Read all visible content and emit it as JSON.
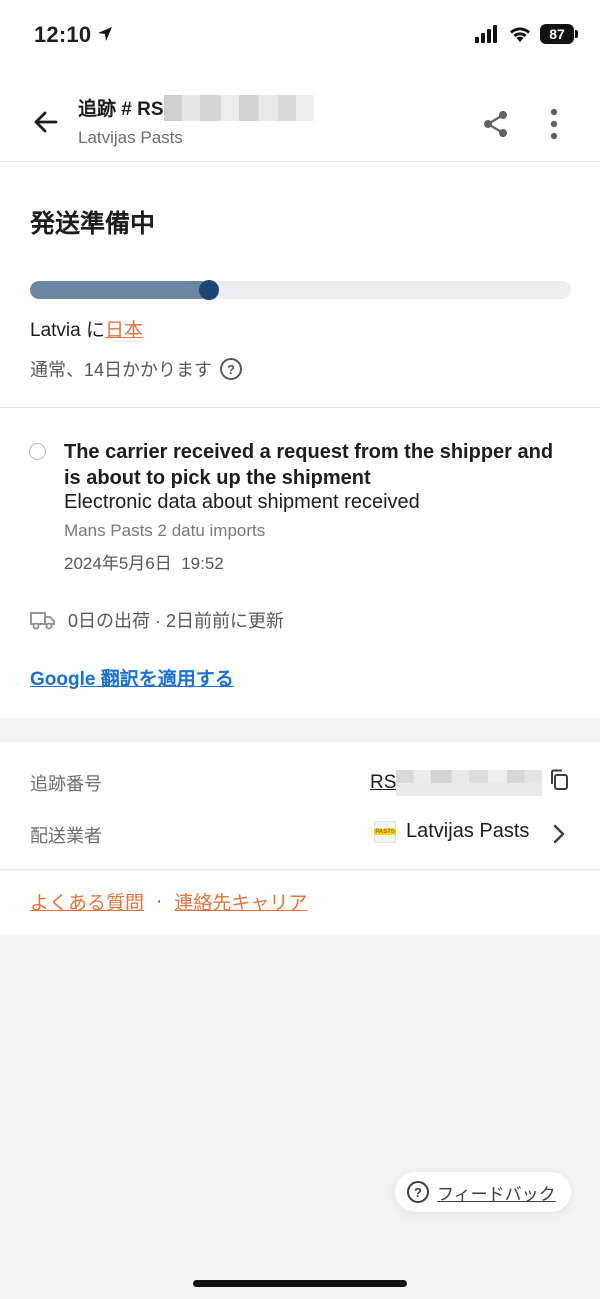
{
  "status_bar": {
    "time": "12:10",
    "battery": "87"
  },
  "header": {
    "title": "追跡 # RS",
    "subtitle": "Latvijas Pasts"
  },
  "shipment": {
    "status": "発送準備中",
    "progress": 0.33,
    "origin": "Latvia",
    "route_connector": " に",
    "destination": "日本",
    "eta": "通常、14日かかります",
    "help_glyph": "?"
  },
  "event": {
    "title": "The carrier received a request from the shipper and is about to pick up the shipment",
    "description": "Electronic data about shipment received",
    "location": "Mans Pasts 2 datu imports",
    "date": "2024年5月6日",
    "time": "19:52"
  },
  "transit_info": "0日の出荷 · 2日前前に更新",
  "translate_link": "Google 翻訳を適用する",
  "info": {
    "tracking_label": "追跡番号",
    "tracking_prefix": "RS",
    "carrier_label": "配送業者",
    "carrier_name": "Latvijas Pasts",
    "carrier_logo_text": "PASTS"
  },
  "links": {
    "faq": "よくある質問",
    "separator": "·",
    "contact": "連絡先キャリア"
  },
  "feedback": {
    "icon": "?",
    "label": "フィードバック"
  },
  "icons": {
    "back": "arrow-left-icon",
    "share": "share-icon",
    "more": "more-vertical-icon",
    "copy": "copy-icon",
    "truck": "truck-icon",
    "chevron": "chevron-right-icon"
  },
  "colors": {
    "accent_orange": "#e8713a",
    "link_blue": "#1a6fd9",
    "progress_fill": "#6b85a3",
    "progress_dot": "#1e4576"
  }
}
